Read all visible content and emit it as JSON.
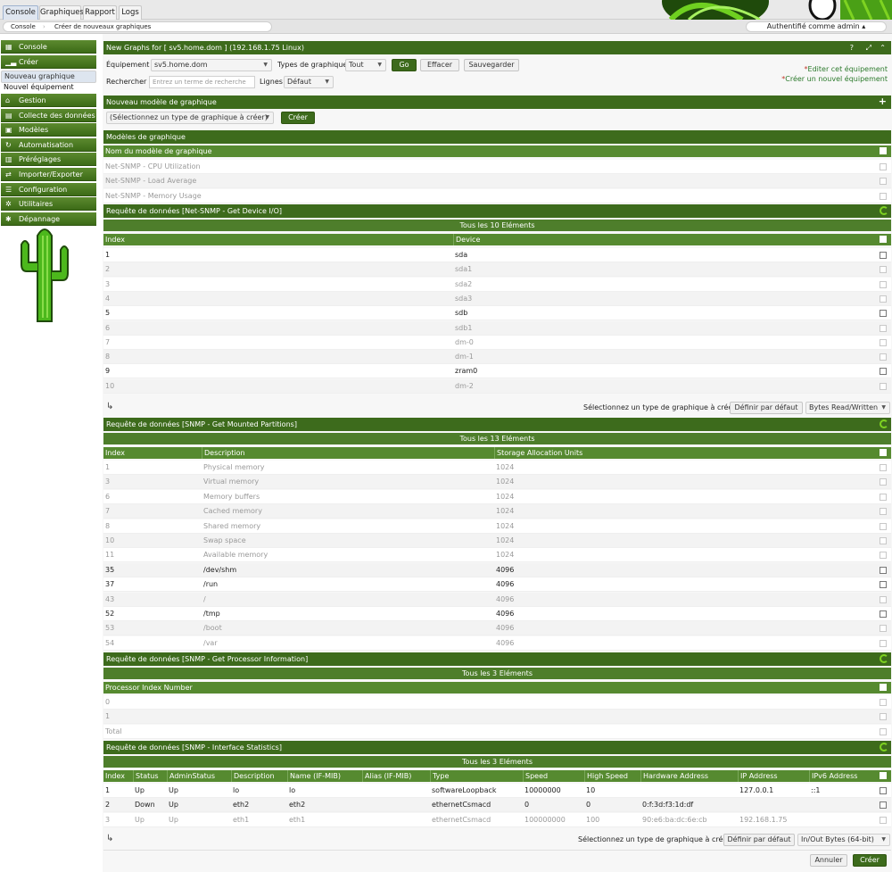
{
  "tabs": [
    "Console",
    "Graphiques",
    "Rapport",
    "Logs"
  ],
  "breadcrumb": [
    "Console",
    "Créer de nouveaux graphiques"
  ],
  "auth": "Authentifié comme admin",
  "sidebar": {
    "items": [
      {
        "label": "Console",
        "icon": "map-icon"
      },
      {
        "label": "Créer",
        "icon": "chart-icon"
      }
    ],
    "sub": [
      "Nouveau graphique",
      "Nouvel équipement"
    ],
    "items2": [
      {
        "label": "Gestion",
        "icon": "home-icon"
      },
      {
        "label": "Collecte des données",
        "icon": "database-icon"
      },
      {
        "label": "Modèles",
        "icon": "templates-icon"
      },
      {
        "label": "Automatisation",
        "icon": "automation-icon"
      },
      {
        "label": "Préréglages",
        "icon": "presets-icon"
      },
      {
        "label": "Importer/Exporter",
        "icon": "exchange-icon"
      },
      {
        "label": "Configuration",
        "icon": "sliders-icon"
      },
      {
        "label": "Utilitaires",
        "icon": "cogs-icon"
      },
      {
        "label": "Dépannage",
        "icon": "bug-icon"
      }
    ]
  },
  "title": "New Graphs for [ sv5.home.dom ] (192.168.1.75 Linux)",
  "filters": {
    "device_label": "Équipement",
    "device_value": "sv5.home.dom",
    "types_label": "Types de graphique",
    "types_value": "Tout",
    "go": "Go",
    "clear": "Effacer",
    "save": "Sauvegarder",
    "search_label": "Rechercher",
    "search_placeholder": "Entrez un terme de recherche",
    "rows_label": "Lignes",
    "rows_value": "Défaut",
    "edit_link": "Editer cet équipement",
    "create_link": "Créer un nouvel équipement"
  },
  "new_template": {
    "header": "Nouveau modèle de graphique",
    "select": "(Sélectionnez un type de graphique à créer)",
    "create": "Créer"
  },
  "templates": {
    "header": "Modèles de graphique",
    "col": "Nom du modèle de graphique",
    "rows": [
      "Net-SNMP - CPU Utilization",
      "Net-SNMP - Load Average",
      "Net-SNMP - Memory Usage"
    ]
  },
  "dq1": {
    "header": "Requête de données [Net-SNMP - Get Device I/O]",
    "count": "Tous les 10 Eléments",
    "cols": [
      "Index",
      "Device"
    ],
    "rows": [
      [
        "1",
        "sda",
        false
      ],
      [
        "2",
        "sda1",
        true
      ],
      [
        "3",
        "sda2",
        true
      ],
      [
        "4",
        "sda3",
        true
      ],
      [
        "5",
        "sdb",
        false
      ],
      [
        "6",
        "sdb1",
        true
      ],
      [
        "7",
        "dm-0",
        true
      ],
      [
        "8",
        "dm-1",
        true
      ],
      [
        "9",
        "zram0",
        false
      ],
      [
        "10",
        "dm-2",
        true
      ]
    ],
    "select_label": "Sélectionnez un type de graphique à créer",
    "default_btn": "Définir par défaut",
    "type_value": "Bytes Read/Written"
  },
  "dq2": {
    "header": "Requête de données [SNMP - Get Mounted Partitions]",
    "count": "Tous les 13 Eléments",
    "cols": [
      "Index",
      "Description",
      "Storage Allocation Units"
    ],
    "rows": [
      [
        "1",
        "Physical memory",
        "1024",
        true
      ],
      [
        "3",
        "Virtual memory",
        "1024",
        true
      ],
      [
        "6",
        "Memory buffers",
        "1024",
        true
      ],
      [
        "7",
        "Cached memory",
        "1024",
        true
      ],
      [
        "8",
        "Shared memory",
        "1024",
        true
      ],
      [
        "10",
        "Swap space",
        "1024",
        true
      ],
      [
        "11",
        "Available memory",
        "1024",
        true
      ],
      [
        "35",
        "/dev/shm",
        "4096",
        false
      ],
      [
        "37",
        "/run",
        "4096",
        false
      ],
      [
        "43",
        "/",
        "4096",
        true
      ],
      [
        "52",
        "/tmp",
        "4096",
        false
      ],
      [
        "53",
        "/boot",
        "4096",
        true
      ],
      [
        "54",
        "/var",
        "4096",
        true
      ]
    ]
  },
  "dq3": {
    "header": "Requête de données [SNMP - Get Processor Information]",
    "count": "Tous les 3 Eléments",
    "cols": [
      "Processor Index Number"
    ],
    "rows": [
      "0",
      "1",
      "Total"
    ]
  },
  "dq4": {
    "header": "Requête de données [SNMP - Interface Statistics]",
    "count": "Tous les 3 Eléments",
    "cols": [
      "Index",
      "Status",
      "AdminStatus",
      "Description",
      "Name (IF-MIB)",
      "Alias (IF-MIB)",
      "Type",
      "Speed",
      "High Speed",
      "Hardware Address",
      "IP Address",
      "IPv6 Address"
    ],
    "rows": [
      [
        "1",
        "Up",
        "Up",
        "lo",
        "lo",
        "",
        "softwareLoopback",
        "10000000",
        "10",
        "",
        "127.0.0.1",
        "::1",
        false
      ],
      [
        "2",
        "Down",
        "Up",
        "eth2",
        "eth2",
        "",
        "ethernetCsmacd",
        "0",
        "0",
        "0:f:3d:f3:1d:df",
        "",
        "",
        false
      ],
      [
        "3",
        "Up",
        "Up",
        "eth1",
        "eth1",
        "",
        "ethernetCsmacd",
        "100000000",
        "100",
        "90:e6:ba:dc:6e:cb",
        "192.168.1.75",
        "",
        true
      ]
    ],
    "select_label": "Sélectionnez un type de graphique à créer",
    "default_btn": "Définir par défaut",
    "type_value": "In/Out Bytes (64-bit)"
  },
  "footer": {
    "cancel": "Annuler",
    "create": "Créer"
  },
  "colors": {
    "header": "#3d6b1c",
    "accent": "#568a30",
    "link": "#2c7a2c"
  }
}
